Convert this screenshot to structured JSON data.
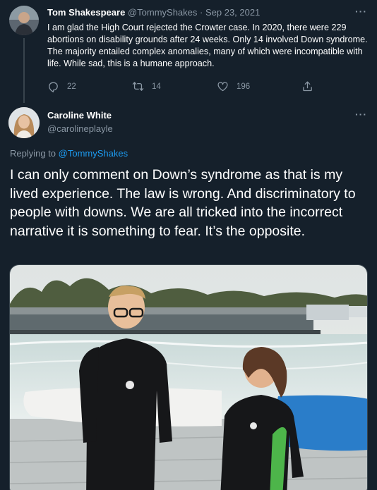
{
  "parent_tweet": {
    "author_name": "Tom Shakespeare",
    "author_handle": "@TommyShakes",
    "separator": "·",
    "date": "Sep 23, 2021",
    "text": "I am glad the High Court rejected the Crowter case. In 2020, there were 229 abortions on disability grounds after 24 weeks. Only 14 involved Down syndrome. The majority entailed complex anomalies, many of which were incompatible with life. While sad, this is a humane approach.",
    "replies": "22",
    "retweets": "14",
    "likes": "196",
    "more_icon": "···"
  },
  "reply_tweet": {
    "author_name": "Caroline White",
    "author_handle": "@carolineplayle",
    "more_icon": "···",
    "replying_prefix": "Replying to ",
    "replying_to": "@TommyShakes",
    "text": "I can only comment on Down’s syndrome as that is my lived experience. The law is wrong. And discriminatory to people with downs. We are all tricked into the incorrect narrative it is something to fear. It’s the opposite."
  },
  "colors": {
    "background": "#15202b",
    "text_primary": "#ffffff",
    "text_secondary": "#8b98a5",
    "link": "#1d9bf0",
    "divider": "#38444d"
  },
  "icons": [
    "reply-icon",
    "retweet-icon",
    "like-icon",
    "share-icon",
    "more-icon"
  ]
}
